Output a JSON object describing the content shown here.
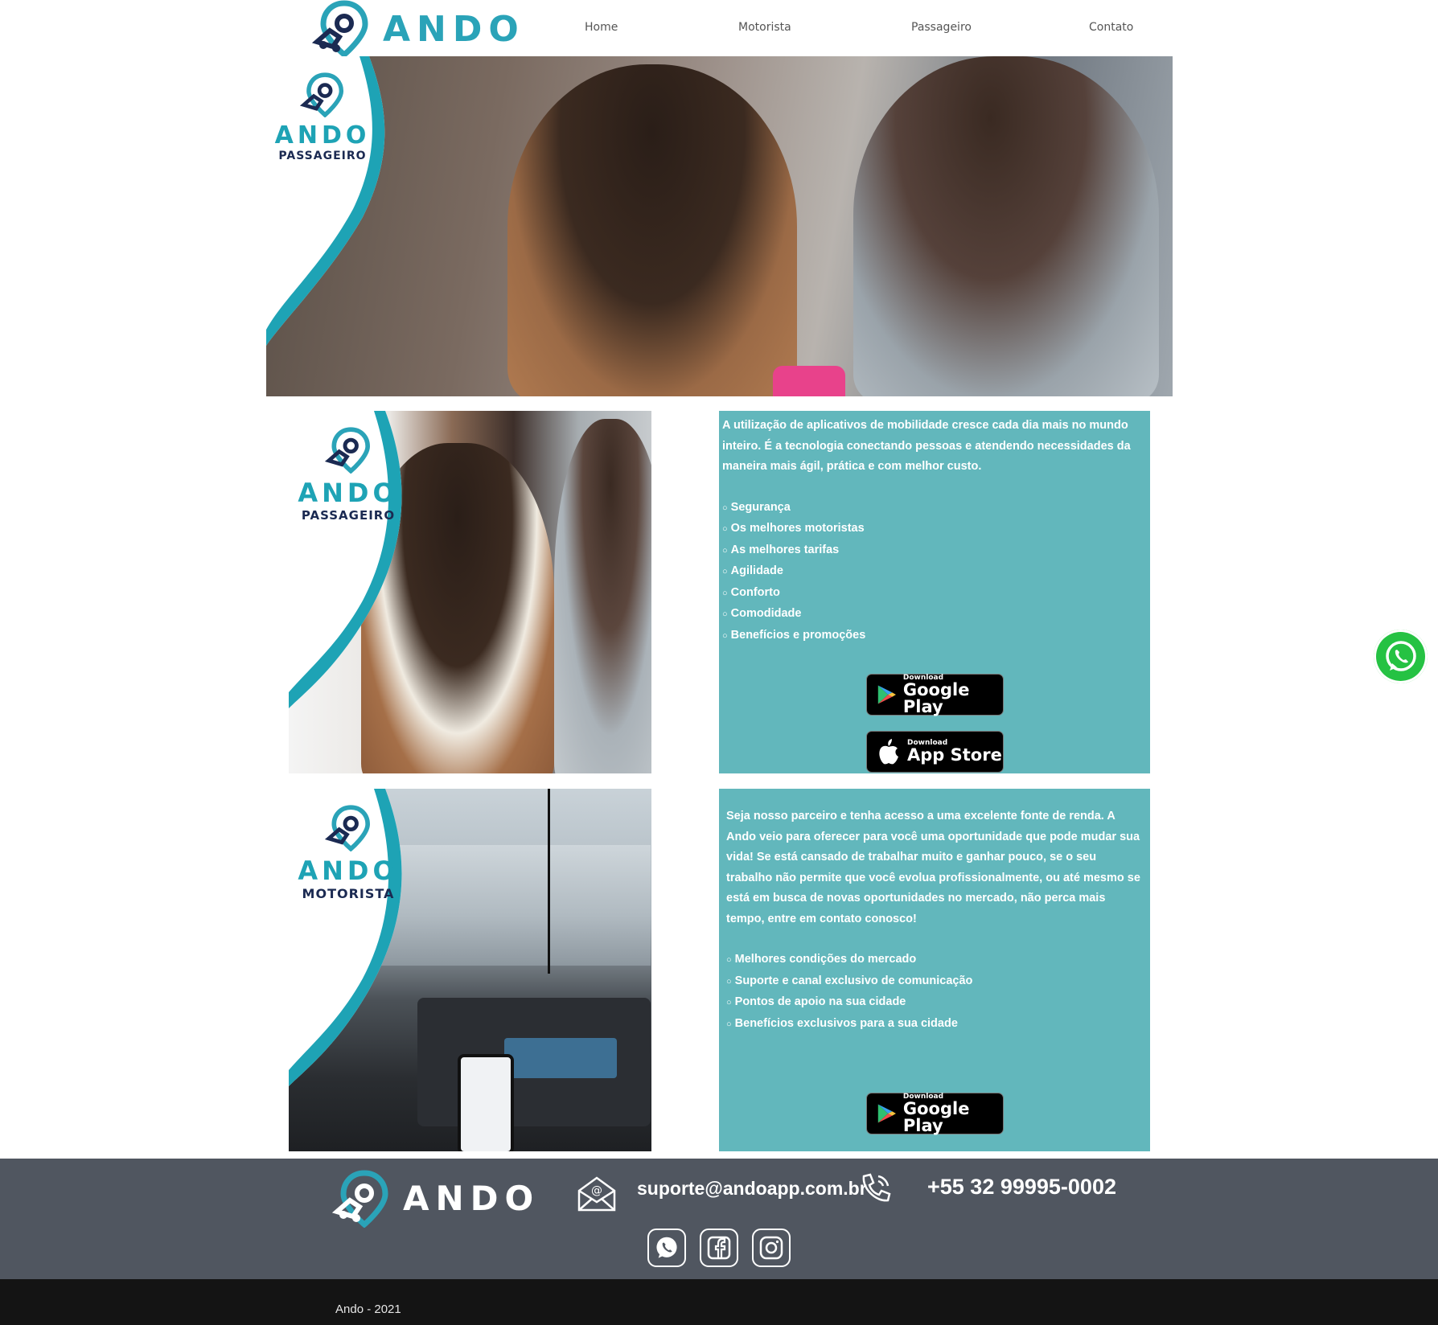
{
  "brand": {
    "name": "ANDO",
    "accent": "#2aa3b8",
    "navy": "#1b2a52",
    "panel_color": "#62b7bc"
  },
  "nav": {
    "items": [
      "Home",
      "Motorista",
      "Passageiro",
      "Contato"
    ]
  },
  "hero": {
    "badge_word": "ANDO",
    "badge_sub": "PASSAGEIRO"
  },
  "passenger": {
    "badge_word": "ANDO",
    "badge_sub": "PASSAGEIRO",
    "intro": "A utilização de aplicativos de mobilidade cresce cada dia mais no mundo inteiro. É a tecnologia conectando pessoas e atendendo necessidades da maneira mais ágil, prática e com melhor custo.",
    "bullets": [
      "Segurança",
      "Os melhores motoristas",
      "As melhores tarifas",
      "Agilidade",
      "Conforto",
      "Comodidade",
      "Benefícios e promoções"
    ],
    "google_small": "Download",
    "google_big": "Google Play",
    "apple_small": "Download",
    "apple_big": "App Store"
  },
  "driver": {
    "badge_word": "ANDO",
    "badge_sub": "MOTORISTA",
    "intro": "Seja nosso parceiro e tenha acesso a uma excelente fonte de renda. A Ando veio para oferecer para você uma oportunidade que pode mudar sua vida! Se está cansado de trabalhar muito e ganhar pouco, se o seu trabalho não permite que você evolua profissionalmente, ou até mesmo se está em busca de novas oportunidades no mercado, não perca mais tempo, entre em contato conosco!",
    "bullets": [
      "Melhores condições do mercado",
      "Suporte e canal exclusivo de comunicação",
      "Pontos de apoio na sua cidade",
      "Benefícios exclusivos para a sua cidade"
    ],
    "google_small": "Download",
    "google_big": "Google Play"
  },
  "footer": {
    "logo_word": "ANDO",
    "email": "suporte@andoapp.com.br",
    "phone": "+55 32 99995-0002",
    "social": [
      "whatsapp-icon",
      "facebook-icon",
      "instagram-icon"
    ],
    "copyright": "Ando - 2021"
  }
}
